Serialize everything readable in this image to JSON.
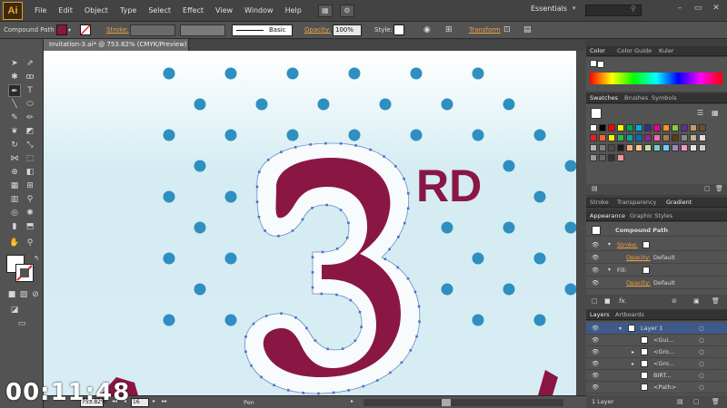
{
  "app": {
    "logo": "Ai"
  },
  "menu": [
    "File",
    "Edit",
    "Object",
    "Type",
    "Select",
    "Effect",
    "View",
    "Window",
    "Help"
  ],
  "workspace": "Essentials",
  "control_bar": {
    "selection_type": "Compound Path",
    "stroke_label": "Stroke:",
    "brush_style": "Basic",
    "opacity_label": "Opacity:",
    "opacity_value": "100%",
    "style_label": "Style:",
    "transform_label": "Transform"
  },
  "document": {
    "tab_title": "Invitation-3.ai* @ 753.82% (CMYK/Preview)",
    "zoom_value": "753.82%",
    "status_tool": "Pen",
    "page_number": "16"
  },
  "artwork": {
    "big_numeral": "3",
    "suffix": "RD",
    "numeral_color": "#8a1644",
    "dot_color": "#2e8fc0"
  },
  "panels": {
    "color_tabs": [
      "Color",
      "Color Guide",
      "Kuler"
    ],
    "swatch_tabs": [
      "Swatches",
      "Brushes",
      "Symbols"
    ],
    "gradient_tabs": [
      "Stroke",
      "Transparency",
      "Gradient"
    ],
    "appearance_tabs": [
      "Appearance",
      "Graphic Styles"
    ],
    "appearance": {
      "title": "Compound Path",
      "rows": [
        {
          "label": "Stroke:",
          "sub": "Opacity:",
          "sub_value": "Default"
        },
        {
          "label": "Fill:",
          "sub": "Opacity:",
          "sub_value": "Default"
        }
      ],
      "fx_label": "fx."
    },
    "layer_tabs": [
      "Layers",
      "Artboards"
    ],
    "layers": [
      {
        "name": "Layer 1"
      },
      {
        "name": "<Gui..."
      },
      {
        "name": "<Gro..."
      },
      {
        "name": "<Gro..."
      },
      {
        "name": "BIRT..."
      },
      {
        "name": "<Path>"
      }
    ],
    "layers_footer": "1 Layer"
  },
  "video_timer": "00:11:48"
}
